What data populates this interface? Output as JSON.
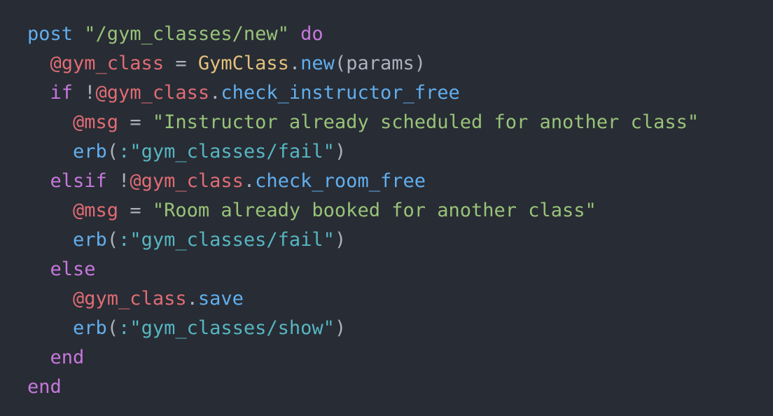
{
  "colors": {
    "background": "#282c34",
    "keyword": "#c678dd",
    "method": "#61afef",
    "instance_variable": "#e06c75",
    "class": "#e5c07b",
    "string": "#98c379",
    "symbol": "#56b6c2",
    "punctuation": "#abb2bf"
  },
  "code": {
    "language": "ruby",
    "lines": [
      {
        "tokens": [
          {
            "type": "method",
            "text": "post"
          },
          {
            "type": "plain",
            "text": " "
          },
          {
            "type": "string",
            "text": "\"/gym_classes/new\""
          },
          {
            "type": "plain",
            "text": " "
          },
          {
            "type": "keyword",
            "text": "do"
          }
        ]
      },
      {
        "tokens": [
          {
            "type": "plain",
            "text": "  "
          },
          {
            "type": "ivar",
            "text": "@gym_class"
          },
          {
            "type": "punct",
            "text": " = "
          },
          {
            "type": "class",
            "text": "GymClass"
          },
          {
            "type": "punct",
            "text": "."
          },
          {
            "type": "method",
            "text": "new"
          },
          {
            "type": "punct",
            "text": "(params)"
          }
        ]
      },
      {
        "tokens": [
          {
            "type": "plain",
            "text": "  "
          },
          {
            "type": "keyword",
            "text": "if"
          },
          {
            "type": "punct",
            "text": " !"
          },
          {
            "type": "ivar",
            "text": "@gym_class"
          },
          {
            "type": "punct",
            "text": "."
          },
          {
            "type": "method",
            "text": "check_instructor_free"
          }
        ]
      },
      {
        "tokens": [
          {
            "type": "plain",
            "text": "    "
          },
          {
            "type": "ivar",
            "text": "@msg"
          },
          {
            "type": "punct",
            "text": " = "
          },
          {
            "type": "string",
            "text": "\"Instructor already scheduled for another class\""
          }
        ]
      },
      {
        "tokens": [
          {
            "type": "plain",
            "text": "    "
          },
          {
            "type": "method",
            "text": "erb"
          },
          {
            "type": "punct",
            "text": "("
          },
          {
            "type": "symbol",
            "text": ":\"gym_classes/fail\""
          },
          {
            "type": "punct",
            "text": ")"
          }
        ]
      },
      {
        "tokens": [
          {
            "type": "plain",
            "text": "  "
          },
          {
            "type": "keyword",
            "text": "elsif"
          },
          {
            "type": "punct",
            "text": " !"
          },
          {
            "type": "ivar",
            "text": "@gym_class"
          },
          {
            "type": "punct",
            "text": "."
          },
          {
            "type": "method",
            "text": "check_room_free"
          }
        ]
      },
      {
        "tokens": [
          {
            "type": "plain",
            "text": "    "
          },
          {
            "type": "ivar",
            "text": "@msg"
          },
          {
            "type": "punct",
            "text": " = "
          },
          {
            "type": "string",
            "text": "\"Room already booked for another class\""
          }
        ]
      },
      {
        "tokens": [
          {
            "type": "plain",
            "text": "    "
          },
          {
            "type": "method",
            "text": "erb"
          },
          {
            "type": "punct",
            "text": "("
          },
          {
            "type": "symbol",
            "text": ":\"gym_classes/fail\""
          },
          {
            "type": "punct",
            "text": ")"
          }
        ]
      },
      {
        "tokens": [
          {
            "type": "plain",
            "text": "  "
          },
          {
            "type": "keyword",
            "text": "else"
          }
        ]
      },
      {
        "tokens": [
          {
            "type": "plain",
            "text": "    "
          },
          {
            "type": "ivar",
            "text": "@gym_class"
          },
          {
            "type": "punct",
            "text": "."
          },
          {
            "type": "method",
            "text": "save"
          }
        ]
      },
      {
        "tokens": [
          {
            "type": "plain",
            "text": "    "
          },
          {
            "type": "method",
            "text": "erb"
          },
          {
            "type": "punct",
            "text": "("
          },
          {
            "type": "symbol",
            "text": ":\"gym_classes/show\""
          },
          {
            "type": "punct",
            "text": ")"
          }
        ]
      },
      {
        "tokens": [
          {
            "type": "plain",
            "text": "  "
          },
          {
            "type": "keyword",
            "text": "end"
          }
        ]
      },
      {
        "tokens": [
          {
            "type": "keyword",
            "text": "end"
          }
        ]
      }
    ]
  }
}
